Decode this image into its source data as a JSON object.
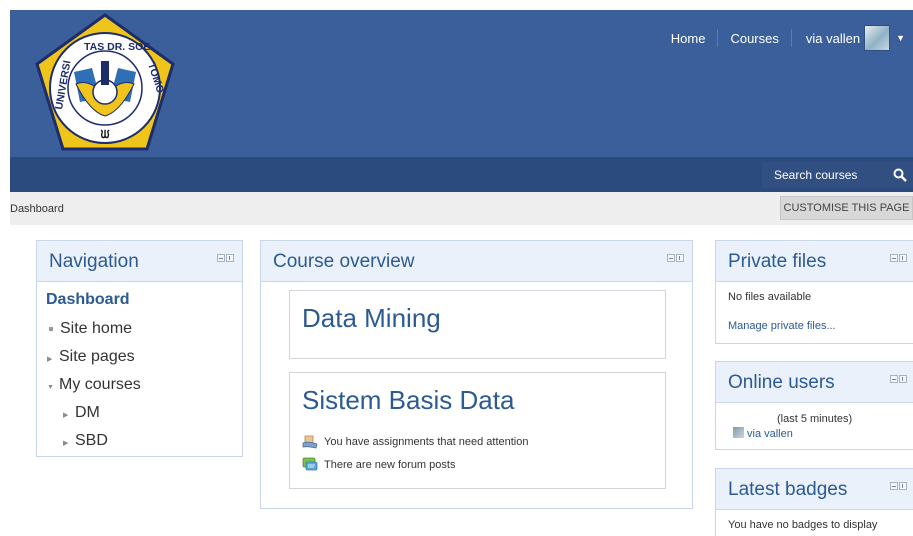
{
  "header": {
    "logo_text_top": "TAS DR. SOE",
    "logo_text_left": "UNIVERSI",
    "logo_text_right": "TOMO",
    "nav": [
      "Home",
      "Courses"
    ],
    "user_name": "via vallen"
  },
  "search": {
    "label": "Search courses"
  },
  "breadcrumb": {
    "item": "Dashboard"
  },
  "customise_label": "CUSTOMISE THIS PAGE",
  "navigation": {
    "title": "Navigation",
    "dashboard": "Dashboard",
    "site_home": "Site home",
    "site_pages": "Site pages",
    "my_courses": "My courses",
    "courses": [
      "DM",
      "SBD"
    ]
  },
  "course_overview": {
    "title": "Course overview",
    "courses": [
      {
        "name": "Data Mining"
      },
      {
        "name": "Sistem Basis Data"
      }
    ],
    "notices": [
      "You have assignments that need attention",
      "There are new forum posts"
    ]
  },
  "private_files": {
    "title": "Private files",
    "empty": "No files available",
    "manage": "Manage private files..."
  },
  "online_users": {
    "title": "Online users",
    "period": "(last 5 minutes)",
    "user": "via vallen"
  },
  "latest_badges": {
    "title": "Latest badges",
    "empty": "You have no badges to display"
  },
  "colors": {
    "header": "#3b5f9b",
    "navbar": "#2b4a7d",
    "link": "#2c5a92",
    "block_head": "#eaf1fb"
  }
}
